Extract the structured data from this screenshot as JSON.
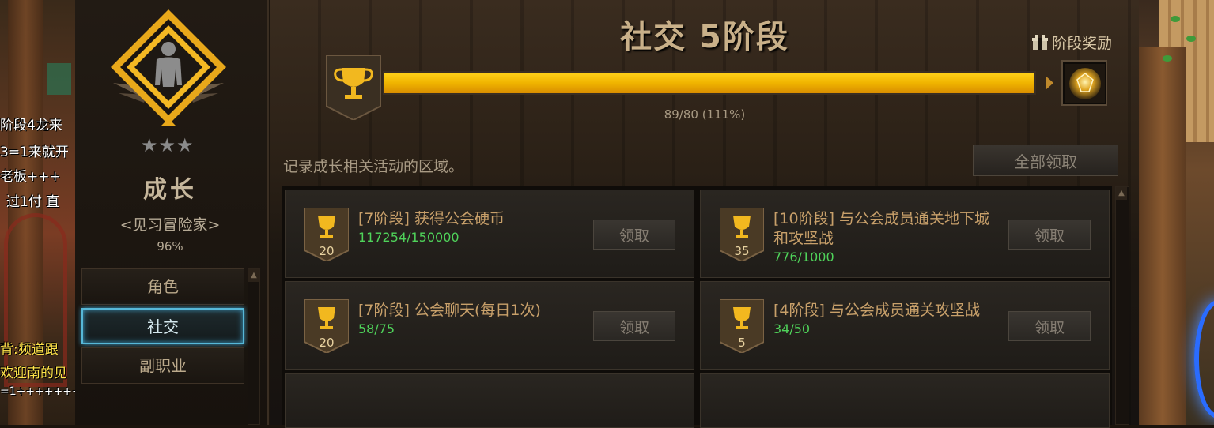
{
  "chat": {
    "lines": [
      "阶段4龙来",
      "3=1来就开",
      "老板+++",
      "过1付 直",
      "背:频道跟",
      "欢迎南的见",
      "=1+++++++"
    ]
  },
  "sidebar": {
    "stars": "★★★",
    "rank_title": "成长",
    "rank_subtitle": "<见习冒险家>",
    "rank_percent": "96%",
    "categories": [
      {
        "label": "角色",
        "active": false
      },
      {
        "label": "社交",
        "active": true
      },
      {
        "label": "副职业",
        "active": false
      }
    ]
  },
  "main": {
    "stage_title": "社交 5阶段",
    "reward_label": "阶段奖励",
    "progress": {
      "current": 89,
      "total": 80,
      "percent": 111,
      "text": "89/80 (111%)"
    },
    "description": "记录成长相关活动的区域。",
    "claim_all_label": "全部领取",
    "tasks": [
      {
        "name": "[7阶段] 获得公会硬币",
        "progress": "117254/150000",
        "points": "20",
        "button": "领取"
      },
      {
        "name": "[10阶段] 与公会成员通关地下城和攻坚战",
        "progress": "776/1000",
        "points": "35",
        "button": "领取"
      },
      {
        "name": "[7阶段] 公会聊天(每日1次)",
        "progress": "58/75",
        "points": "20",
        "button": "领取"
      },
      {
        "name": "[4阶段] 与公会成员通关攻坚战",
        "progress": "34/50",
        "points": "5",
        "button": "领取"
      }
    ]
  },
  "colors": {
    "accent_gold": "#f0b400",
    "progress_green": "#4fd35a",
    "task_title": "#c8a06a",
    "active_tab_border": "#57b8d8"
  },
  "icons": {
    "emblem": "person-diamond-emblem-icon",
    "trophy": "trophy-icon",
    "gift": "gift-icon",
    "reward_orb": "reward-orb-icon"
  }
}
